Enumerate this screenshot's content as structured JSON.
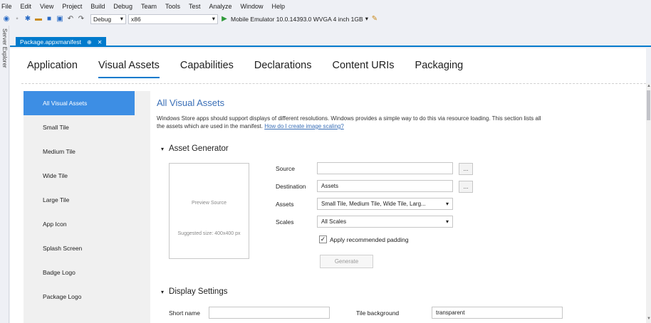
{
  "menu": [
    "File",
    "Edit",
    "View",
    "Project",
    "Build",
    "Debug",
    "Team",
    "Tools",
    "Test",
    "Analyze",
    "Window",
    "Help"
  ],
  "toolbar": {
    "config": "Debug",
    "platform": "x86",
    "run_label": "Mobile Emulator 10.0.14393.0 WVGA 4 inch 1GB"
  },
  "side_panel_label": "Server Explorer",
  "document_tab": {
    "title": "Package.appxmanifest",
    "pin": "⊕",
    "close": "✕"
  },
  "main_tabs": [
    "Application",
    "Visual Assets",
    "Capabilities",
    "Declarations",
    "Content URIs",
    "Packaging"
  ],
  "nav": [
    "All Visual Assets",
    "Small Tile",
    "Medium Tile",
    "Wide Tile",
    "Large Tile",
    "App Icon",
    "Splash Screen",
    "Badge Logo",
    "Package Logo"
  ],
  "content": {
    "title": "All Visual Assets",
    "description": "Windows Store apps should support displays of different resolutions. Windows provides a simple way to do this via resource loading. This section lists all the assets which are used in the manifest.",
    "help_link": "How do I create image scaling?",
    "asset_generator": {
      "heading": "Asset Generator",
      "preview_text": "Preview Source",
      "suggested_size": "Suggested size: 400x400 px",
      "source_label": "Source",
      "source_value": "",
      "destination_label": "Destination",
      "destination_value": "Assets",
      "assets_label": "Assets",
      "assets_value": "Small Tile, Medium Tile, Wide Tile, Larg...",
      "scales_label": "Scales",
      "scales_value": "All Scales",
      "padding_label": "Apply recommended padding",
      "padding_checked": true,
      "browse_label": "...",
      "generate_label": "Generate"
    },
    "display_settings": {
      "heading": "Display Settings",
      "short_name_label": "Short name",
      "short_name_value": "",
      "tile_background_label": "Tile background",
      "tile_background_value": "transparent"
    }
  },
  "colors": {
    "accent": "#007acc",
    "nav_active": "#3d8ee4",
    "title_blue": "#3a6fb7"
  }
}
